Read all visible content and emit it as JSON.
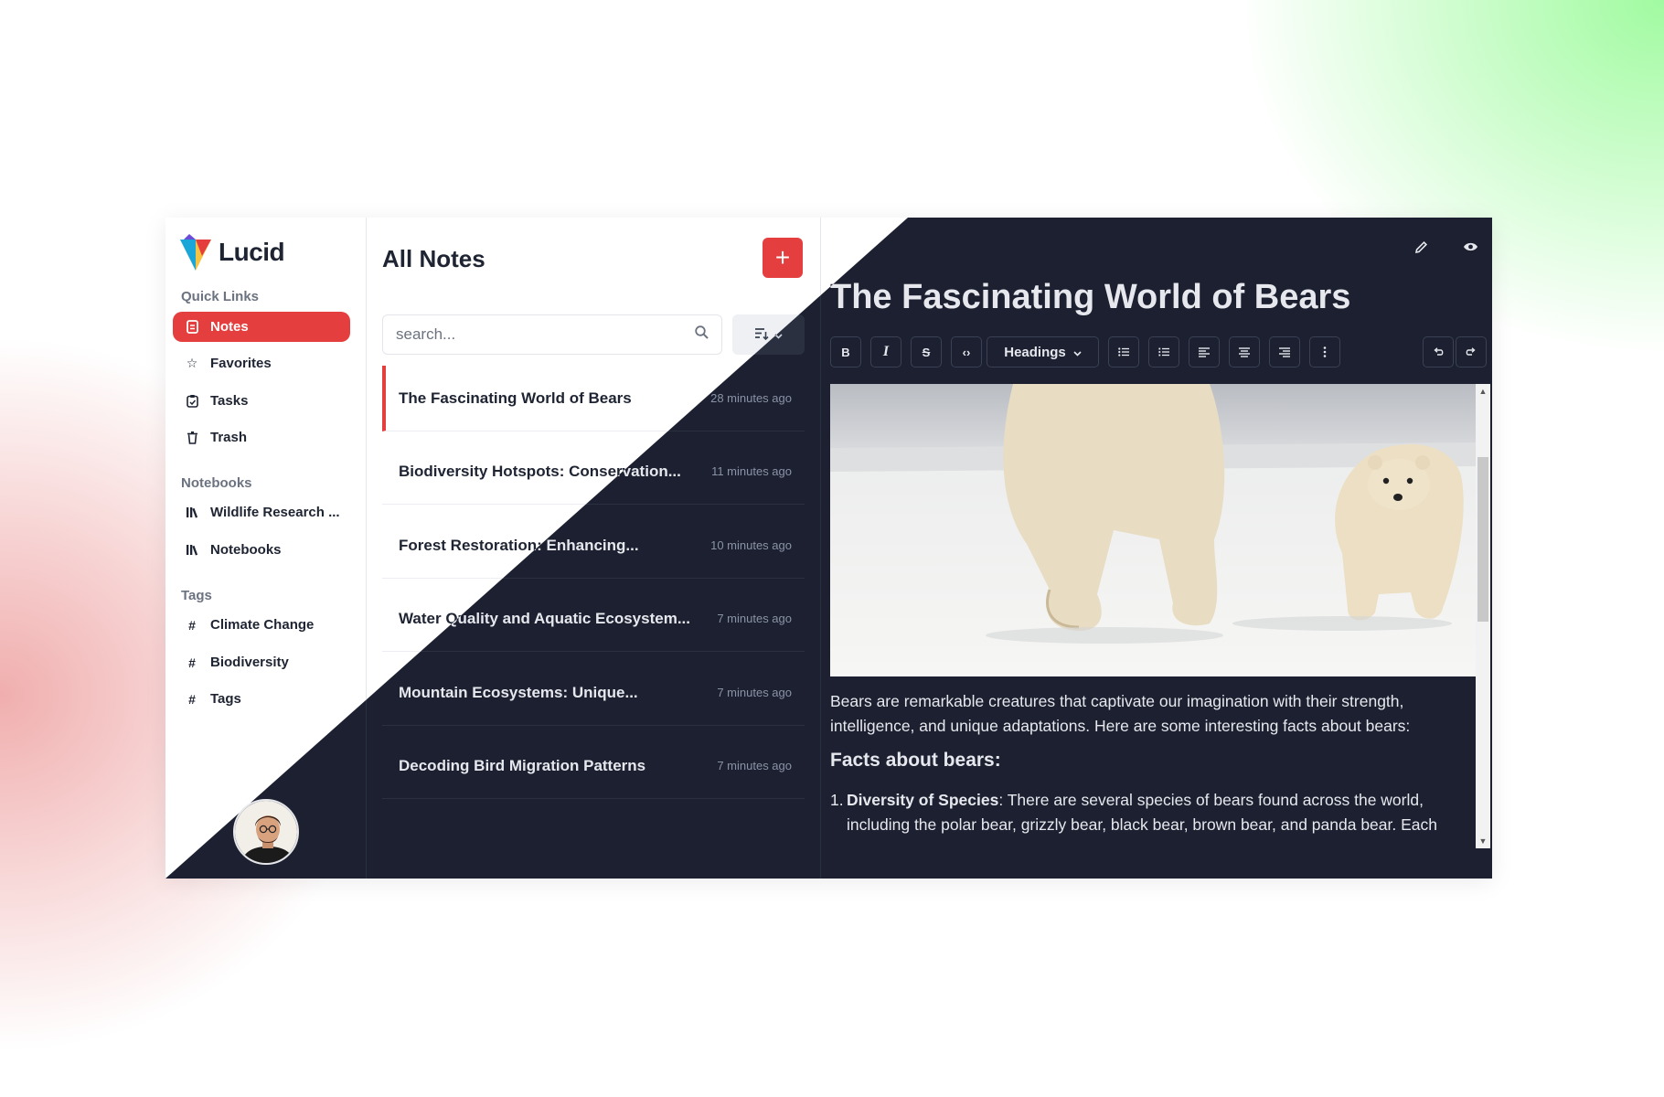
{
  "app": {
    "name": "Lucid"
  },
  "sidebar": {
    "quick_links_title": "Quick Links",
    "quick_links": [
      {
        "label": "Notes",
        "icon": "note-icon",
        "active": true
      },
      {
        "label": "Favorites",
        "icon": "star-icon"
      },
      {
        "label": "Tasks",
        "icon": "clipboard-icon"
      },
      {
        "label": "Trash",
        "icon": "trash-icon"
      }
    ],
    "notebooks_title": "Notebooks",
    "notebooks": [
      {
        "label": "Wildlife Research ...",
        "icon": "library-icon"
      },
      {
        "label": "Notebooks",
        "icon": "library-icon"
      }
    ],
    "tags_title": "Tags",
    "tags": [
      {
        "label": "Climate Change",
        "icon": "hash-icon"
      },
      {
        "label": "Biodiversity",
        "icon": "hash-icon"
      },
      {
        "label": "Tags",
        "icon": "hash-icon"
      }
    ]
  },
  "note_list": {
    "title": "All Notes",
    "add_label": "+",
    "search_placeholder": "search...",
    "notes": [
      {
        "title": "The Fascinating World of Bears",
        "time": "28 minutes ago",
        "active": true
      },
      {
        "title": "Biodiversity Hotspots: Conservation...",
        "time": "11 minutes ago"
      },
      {
        "title": "Forest Restoration: Enhancing...",
        "time": "10 minutes ago"
      },
      {
        "title": "Water Quality and Aquatic Ecosystem...",
        "time": "7 minutes ago"
      },
      {
        "title": "Mountain Ecosystems: Unique...",
        "time": "7 minutes ago"
      },
      {
        "title": "Decoding Bird Migration Patterns",
        "time": "7 minutes ago"
      }
    ]
  },
  "editor": {
    "title": "The Fascinating World of Bears",
    "toolbar": {
      "bold": "B",
      "italic": "I",
      "strike": "S",
      "code": "‹›",
      "headings": "Headings"
    },
    "intro": "Bears are remarkable creatures that captivate our imagination with their strength, intelligence, and unique adaptations. Here are some interesting facts about bears:",
    "heading": "Facts about bears:",
    "list_num": "1.",
    "list_bold": "Diversity of Species",
    "list_text": ": There are several species of bears found across the world, including the polar bear, grizzly bear, black bear, brown bear, and panda bear. Each"
  },
  "colors": {
    "accent": "#e53e3e",
    "dark_bg": "#1c2030",
    "light_bg": "#ffffff"
  }
}
